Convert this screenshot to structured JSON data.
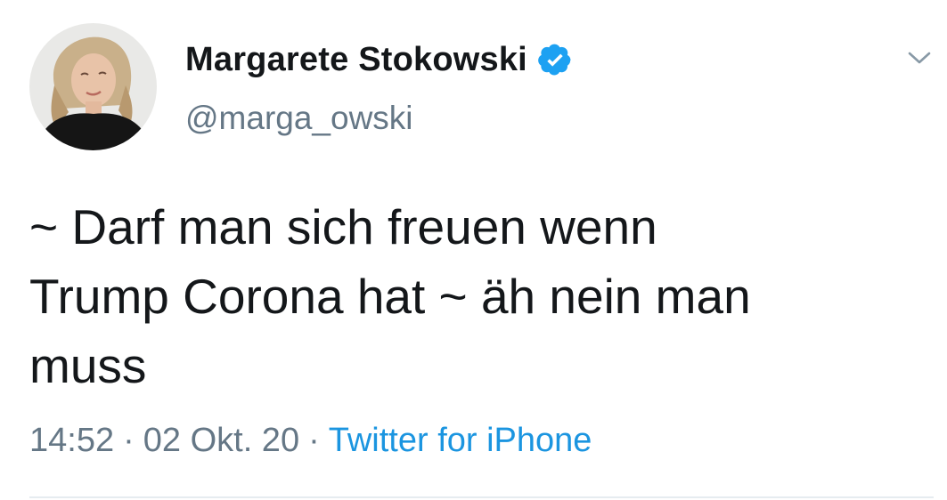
{
  "tweet": {
    "author": {
      "display_name": "Margarete Stokowski",
      "handle": "@marga_owski",
      "verified": true
    },
    "text": "~ Darf man sich freuen wenn\nTrump Corona hat ~ äh nein man\nmuss",
    "time": "14:52",
    "date": "02 Okt. 20",
    "separator": "·",
    "source": "Twitter for iPhone"
  },
  "icons": {
    "verified": "verified-badge-icon",
    "menu": "chevron-down-icon"
  },
  "colors": {
    "text": "#14171a",
    "secondary": "#657786",
    "link": "#1b95e0",
    "verified": "#1da1f2",
    "divider": "#e6ecf0"
  }
}
